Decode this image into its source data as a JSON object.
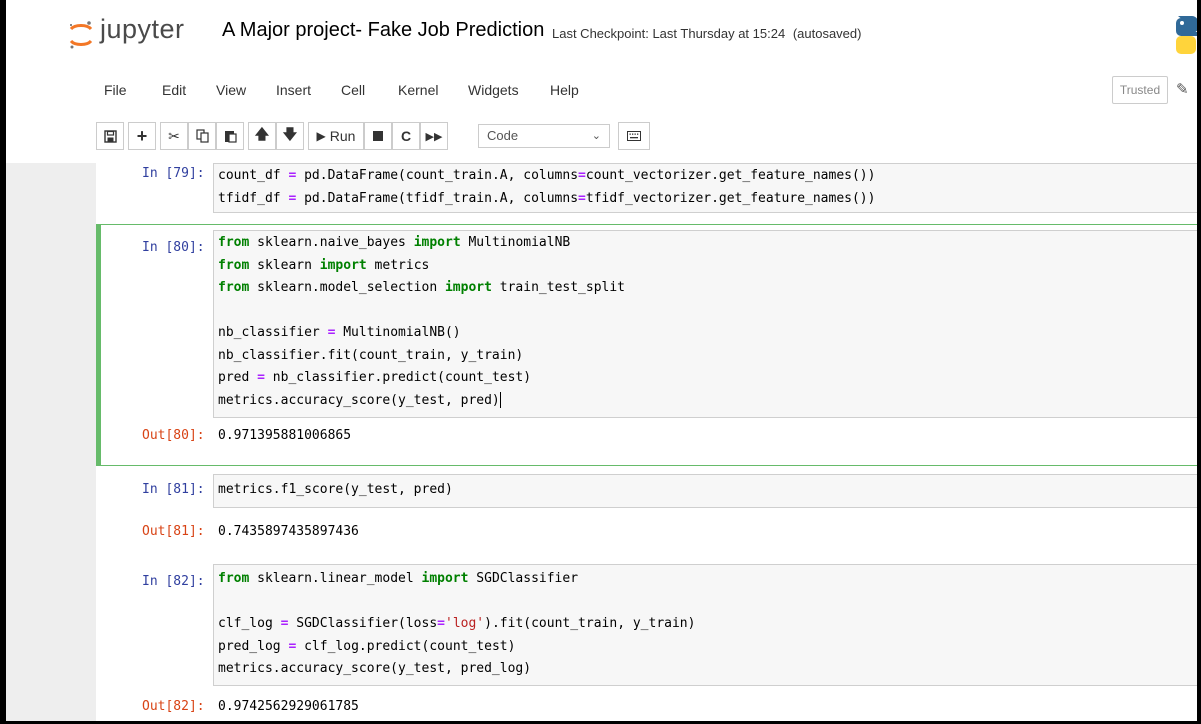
{
  "header": {
    "logo_text": "jupyter",
    "notebook_title": "A Major project- Fake Job Prediction",
    "checkpoint": "Last Checkpoint: Last Thursday at 15:24",
    "autosave_status": "(autosaved)",
    "trusted_label": "Trusted"
  },
  "menu": [
    "File",
    "Edit",
    "View",
    "Insert",
    "Cell",
    "Kernel",
    "Widgets",
    "Help"
  ],
  "toolbar": {
    "run_label": "Run",
    "cell_type": "Code"
  },
  "cells": [
    {
      "in_prompt": "In [79]:",
      "lines": [
        "count_df = pd.DataFrame(count_train.A, columns=count_vectorizer.get_feature_names())",
        "tfidf_df = pd.DataFrame(tfidf_train.A, columns=tfidf_vectorizer.get_feature_names())"
      ]
    },
    {
      "in_prompt": "In [80]:",
      "lines": [
        "from sklearn.naive_bayes import MultinomialNB",
        "from sklearn import metrics",
        "from sklearn.model_selection import train_test_split",
        "",
        "nb_classifier = MultinomialNB()",
        "nb_classifier.fit(count_train, y_train)",
        "pred = nb_classifier.predict(count_test)",
        "metrics.accuracy_score(y_test, pred)"
      ],
      "out_prompt": "Out[80]:",
      "output": "0.971395881006865"
    },
    {
      "in_prompt": "In [81]:",
      "lines": [
        "metrics.f1_score(y_test, pred)"
      ],
      "out_prompt": "Out[81]:",
      "output": "0.7435897435897436"
    },
    {
      "in_prompt": "In [82]:",
      "lines": [
        "from sklearn.linear_model import SGDClassifier",
        "",
        "clf_log = SGDClassifier(loss='log').fit(count_train, y_train)",
        "pred_log = clf_log.predict(count_test)",
        "metrics.accuracy_score(y_test, pred_log)"
      ],
      "out_prompt": "Out[82]:",
      "output": "0.9742562929061785"
    }
  ]
}
